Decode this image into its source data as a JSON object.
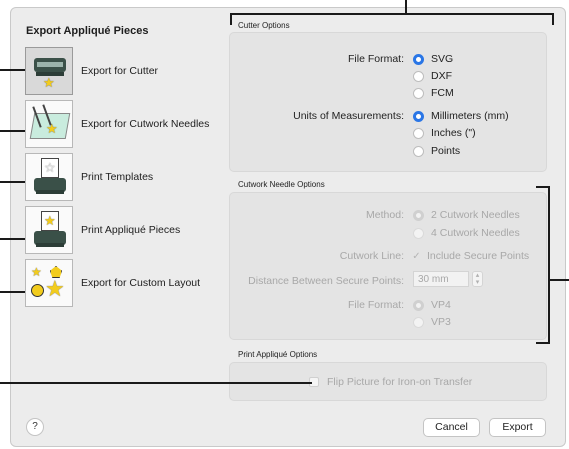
{
  "sidebar": {
    "title": "Export Appliqué Pieces",
    "items": [
      {
        "label": "Export for Cutter",
        "icon": "cutter-printer-icon"
      },
      {
        "label": "Export for Cutwork Needles",
        "icon": "cutwork-needles-icon"
      },
      {
        "label": "Print Templates",
        "icon": "print-templates-icon"
      },
      {
        "label": "Print Appliqué Pieces",
        "icon": "print-applique-icon"
      },
      {
        "label": "Export for Custom Layout",
        "icon": "custom-layout-icon"
      }
    ]
  },
  "cutter_options": {
    "title": "Cutter Options",
    "file_format_label": "File Format:",
    "file_format_options": [
      "SVG",
      "DXF",
      "FCM"
    ],
    "file_format_selected": "SVG",
    "units_label": "Units of Measurements:",
    "units_options": [
      "Millimeters (mm)",
      "Inches (\")",
      "Points"
    ],
    "units_selected": "Millimeters (mm)"
  },
  "cutwork_options": {
    "title": "Cutwork Needle Options",
    "method_label": "Method:",
    "method_options": [
      "2 Cutwork Needles",
      "4 Cutwork Needles"
    ],
    "method_selected": "2 Cutwork Needles",
    "cutwork_line_label": "Cutwork Line:",
    "include_secure_points": "Include Secure Points",
    "distance_label": "Distance Between Secure Points:",
    "distance_value": "30 mm",
    "file_format_label": "File Format:",
    "file_format_options": [
      "VP4",
      "VP3"
    ],
    "file_format_selected": "VP4"
  },
  "print_options": {
    "title": "Print Appliqué Options",
    "flip_label": "Flip Picture for Iron-on Transfer"
  },
  "footer": {
    "help_label": "?",
    "cancel_label": "Cancel",
    "export_label": "Export"
  },
  "colors": {
    "accent": "#2a76e6",
    "star": "#f2cc1d",
    "printer": "#3a5048"
  }
}
